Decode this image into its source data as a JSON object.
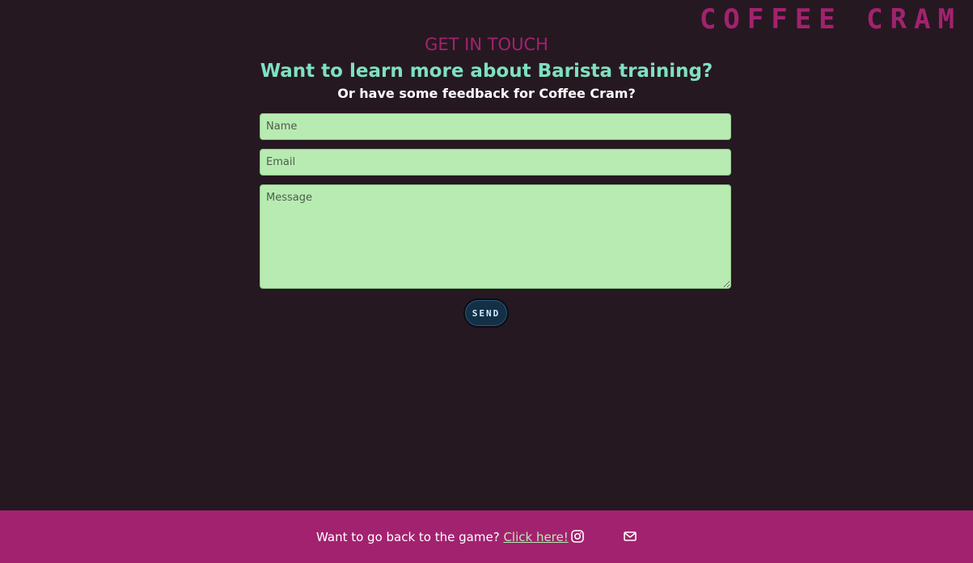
{
  "brand": {
    "logo": "COFFEE CRAM"
  },
  "contact": {
    "eyebrow": "GET IN TOUCH",
    "headline": "Want to learn more about Barista training?",
    "subheadline": "Or have some feedback for Coffee Cram?"
  },
  "form": {
    "name_placeholder": "Name",
    "email_placeholder": "Email",
    "message_placeholder": "Message",
    "send_label": "SEND"
  },
  "footer": {
    "text": "Want to go back to the game? ",
    "link_label": "Click here!",
    "icons": [
      "instagram-icon",
      "mail-icon"
    ]
  },
  "colors": {
    "background": "#261821",
    "brand_magenta": "#a3226f",
    "headline_teal": "#7fe0c0",
    "field_green": "#b8ebb2",
    "button_navy": "#143047"
  }
}
